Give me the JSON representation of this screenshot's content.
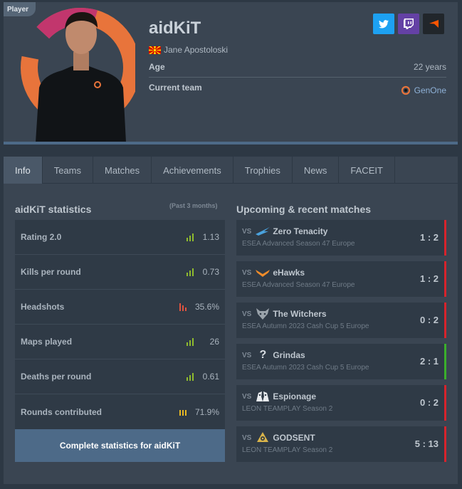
{
  "player": {
    "badge": "Player",
    "nickname": "aidKiT",
    "real_name": "Jane Apostoloski",
    "age_label": "Age",
    "age_value": "22 years",
    "team_label": "Current team",
    "team_name": "GenOne"
  },
  "tabs": [
    "Info",
    "Teams",
    "Matches",
    "Achievements",
    "Trophies",
    "News",
    "FACEIT"
  ],
  "stats": {
    "title": "aidKiT statistics",
    "period": "(Past 3 months)",
    "items": [
      {
        "name": "Rating 2.0",
        "value": "1.13",
        "color": "#8fbb2e"
      },
      {
        "name": "Kills per round",
        "value": "0.73",
        "color": "#8fbb2e"
      },
      {
        "name": "Headshots",
        "value": "35.6%",
        "color": "#e0533f"
      },
      {
        "name": "Maps played",
        "value": "26",
        "color": "#8fbb2e"
      },
      {
        "name": "Deaths per round",
        "value": "0.61",
        "color": "#8fbb2e"
      },
      {
        "name": "Rounds contributed",
        "value": "71.9%",
        "color": "#e8b923"
      }
    ],
    "complete_label": "Complete statistics for aidKiT"
  },
  "matches": {
    "title": "Upcoming & recent matches",
    "vs_label": "VS",
    "items": [
      {
        "opponent": "Zero Tenacity",
        "event": "ESEA Advanced Season 47 Europe",
        "score": "1 : 2",
        "result": "loss"
      },
      {
        "opponent": "eHawks",
        "event": "ESEA Advanced Season 47 Europe",
        "score": "1 : 2",
        "result": "loss"
      },
      {
        "opponent": "The Witchers",
        "event": "ESEA Autumn 2023 Cash Cup 5 Europe",
        "score": "0 : 2",
        "result": "loss"
      },
      {
        "opponent": "Grindas",
        "event": "ESEA Autumn 2023 Cash Cup 5 Europe",
        "score": "2 : 1",
        "result": "win"
      },
      {
        "opponent": "Espionage",
        "event": "LEON TEAMPLAY Season 2",
        "score": "0 : 2",
        "result": "loss"
      },
      {
        "opponent": "GODSENT",
        "event": "LEON TEAMPLAY Season 2",
        "score": "5 : 13",
        "result": "loss"
      }
    ]
  }
}
